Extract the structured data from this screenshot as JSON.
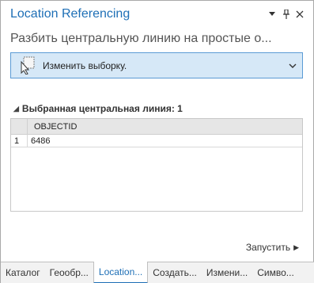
{
  "pane": {
    "title": "Location Referencing",
    "subtitle": "Разбить центральную линию на простые о...",
    "controls": {
      "dropdown": "▾",
      "pin": "📌",
      "close": "✕"
    }
  },
  "selector": {
    "label": "Изменить выборку.",
    "icon": "selection-cursor-icon"
  },
  "section": {
    "label": "Выбранная центральная линия: 1"
  },
  "table": {
    "columns": [
      "OBJECTID"
    ],
    "rows": [
      {
        "num": "1",
        "objectid": "6486"
      }
    ]
  },
  "run": {
    "label": "Запустить"
  },
  "tabs": [
    {
      "label": "Каталог"
    },
    {
      "label": "Геообр..."
    },
    {
      "label": "Location..."
    },
    {
      "label": "Создать..."
    },
    {
      "label": "Измени..."
    },
    {
      "label": "Симво..."
    }
  ],
  "colors": {
    "accent": "#1e6fb6",
    "selector_bg": "#d6e8f7",
    "selector_border": "#5b9bd5"
  }
}
